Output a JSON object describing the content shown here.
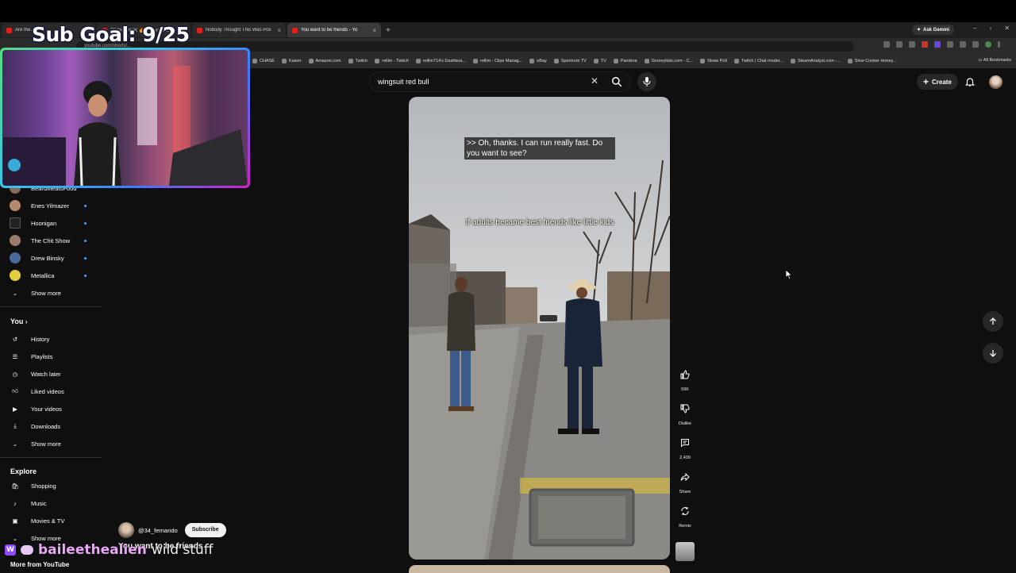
{
  "browser": {
    "tabs": [
      {
        "label": "Are the...",
        "active": false
      },
      {
        "label": "TECKTONIK 🔥 #shorts #edm #",
        "active": false
      },
      {
        "label": "Nobody Thought This Was Pos",
        "active": false
      },
      {
        "label": "You want to be friends - Yo",
        "active": true
      }
    ],
    "ask_gemini": "Ask Gemini",
    "url": "youtube.com/shorts/...",
    "bookmarks": [
      "CHASE",
      "Kaiser",
      "Amazon.com",
      "Twitch",
      "rellim - Twitch",
      "rellim714's Dashboa...",
      "rellim - Clips Manag...",
      "eBay",
      "Spectrum TV",
      "TV",
      "Pandora",
      "Groovylists.com - C...",
      "Straw Poll",
      "Twitch | Chat moder...",
      "SteamAnalyst.com -...",
      "Slow Cooker Honey..."
    ],
    "all_bookmarks": "All Bookmarks"
  },
  "youtube": {
    "search_value": "wingsuit red bull",
    "create_label": "Create"
  },
  "sidebar": {
    "subscriptions": [
      {
        "label": "BeardMeatsFood",
        "color": "#8a6a50"
      },
      {
        "label": "Enes Yilmazer",
        "color": "#b58a6a"
      },
      {
        "label": "Hoonigan",
        "color": "#222222"
      },
      {
        "label": "The Chit Show",
        "color": "#9a7a6a"
      },
      {
        "label": "Drew Binsky",
        "color": "#4a6a9a"
      },
      {
        "label": "Metallica",
        "color": "#e0d040"
      }
    ],
    "show_more": "Show more",
    "you_header": "You",
    "you_items": [
      "History",
      "Playlists",
      "Watch later",
      "Liked videos",
      "Your videos",
      "Downloads"
    ],
    "explore_header": "Explore",
    "explore_items": [
      "Shopping",
      "Music",
      "Movies & TV"
    ],
    "more_header": "More from YouTube"
  },
  "stream": {
    "sub_goal": "Sub Goal: 9/25",
    "chat_user": "baileethealien",
    "chat_message": "wild stuff"
  },
  "short": {
    "caption_top": ">> Oh, thanks. I can run really fast. Do you want to see?",
    "caption_overlay": "If adults became best friends like little kids",
    "likes": "59K",
    "dislike_label": "Dislike",
    "comments": "2,439",
    "share_label": "Share",
    "remix_label": "Remix",
    "channel": "@34_fernando",
    "subscribe_label": "Subscribe",
    "title": "You want to be friends"
  },
  "colors": {
    "background": "#0f0f0f",
    "accent_blue": "#3ea6ff",
    "chat_name": "#e9a7f5"
  }
}
